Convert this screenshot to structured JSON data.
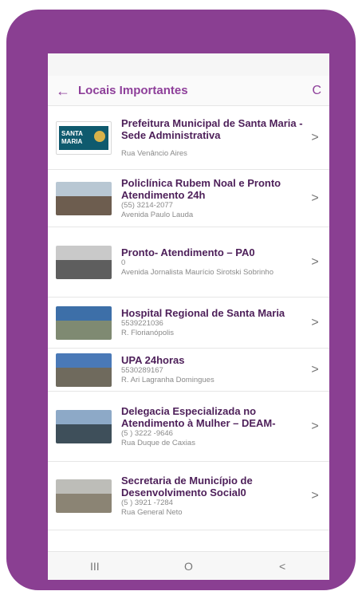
{
  "header": {
    "title": "Locais Importantes",
    "back_icon": "←",
    "refresh_icon": "C"
  },
  "items": [
    {
      "name": "Prefeitura Municipal de Santa Maria - Sede Administrativa",
      "phone": "",
      "address": "Rua Venâncio Aires",
      "thumbnail": "santa-maria-logo"
    },
    {
      "name": "Policlínica Rubem Noal e Pronto Atendimento 24h",
      "phone": "(55) 3214-2077",
      "address": "Avenida Paulo Lauda",
      "thumbnail": "building-photo"
    },
    {
      "name": "Pronto- Atendimento – PA0",
      "phone": "0",
      "address": "Avenida Jornalista Maurício Sirotski Sobrinho",
      "thumbnail": "building-photo"
    },
    {
      "name": "Hospital Regional de Santa Maria",
      "phone": "5539221036",
      "address": "R. Florianópolis",
      "thumbnail": "building-photo"
    },
    {
      "name": "UPA 24horas",
      "phone": "5530289167",
      "address": "R. Ari Lagranha Domingues",
      "thumbnail": "building-photo"
    },
    {
      "name": "Delegacia Especializada no Atendimento à Mulher – DEAM-",
      "phone": "(5 ) 3222 -9646",
      "address": "Rua Duque de Caxias",
      "thumbnail": "building-photo"
    },
    {
      "name": "Secretaria de Município de Desenvolvimento Social0",
      "phone": "(5 ) 3921 -7284",
      "address": "Rua General Neto",
      "thumbnail": "building-photo"
    }
  ],
  "logo": {
    "line1": "SANTA",
    "line2": "MARIA"
  },
  "navbar": {
    "recent": "III",
    "home": "O",
    "back": "<"
  },
  "colors": {
    "frame": "#8a3f92",
    "accent": "#8e3f9a",
    "item_title": "#4d1f59"
  }
}
